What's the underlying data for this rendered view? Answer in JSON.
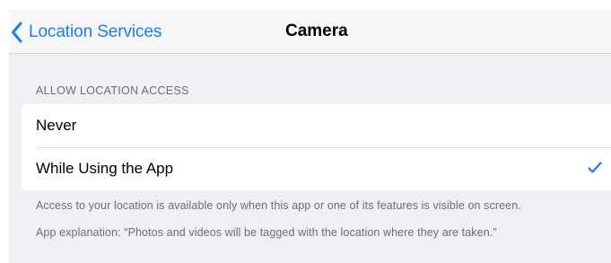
{
  "navbar": {
    "back_label": "Location Services",
    "title": "Camera"
  },
  "section": {
    "header": "ALLOW LOCATION ACCESS",
    "options": [
      {
        "label": "Never",
        "selected": false
      },
      {
        "label": "While Using the App",
        "selected": true
      }
    ]
  },
  "footer": {
    "line1": "Access to your location is available only when this app or one of its features is visible on screen.",
    "line2": "App explanation: “Photos and videos will be tagged with the location where they are taken.”"
  },
  "colors": {
    "accent": "#157efb",
    "background": "#efeff4",
    "secondary_text": "#6d6d72"
  },
  "icons": {
    "back": "chevron-left-icon",
    "selected": "checkmark-icon"
  }
}
